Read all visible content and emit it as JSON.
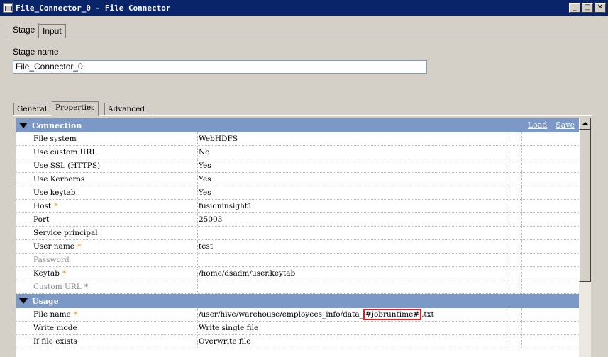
{
  "window": {
    "title": "File_Connector_0 - File Connector",
    "min_label": "_",
    "max_label": "□",
    "close_label": "✕"
  },
  "tabs": [
    {
      "label": "Stage",
      "active": true
    },
    {
      "label": "Input",
      "active": false
    }
  ],
  "stage_name": {
    "label": "Stage name",
    "value": "File_Connector_0"
  },
  "subtabs": [
    {
      "label": "General",
      "active": false
    },
    {
      "label": "Properties",
      "active": true
    },
    {
      "label": "Advanced",
      "active": false
    }
  ],
  "connection": {
    "title": "Connection",
    "load_label": "Load",
    "save_label": "Save",
    "rows": [
      {
        "name": "File system",
        "value": "WebHDFS",
        "required": false,
        "disabled": false
      },
      {
        "name": "Use custom URL",
        "value": "No",
        "required": false,
        "disabled": false
      },
      {
        "name": "Use SSL (HTTPS)",
        "value": "Yes",
        "required": false,
        "disabled": false
      },
      {
        "name": "Use Kerberos",
        "value": "Yes",
        "required": false,
        "disabled": false
      },
      {
        "name": "Use keytab",
        "value": "Yes",
        "required": false,
        "disabled": false
      },
      {
        "name": "Host",
        "value": "fusioninsight1",
        "required": true,
        "disabled": false
      },
      {
        "name": "Port",
        "value": "25003",
        "required": false,
        "disabled": false
      },
      {
        "name": "Service principal",
        "value": "",
        "required": false,
        "disabled": false
      },
      {
        "name": "User name",
        "value": "test",
        "required": true,
        "disabled": false
      },
      {
        "name": "Password",
        "value": "",
        "required": false,
        "disabled": true
      },
      {
        "name": "Keytab",
        "value": "/home/dsadm/user.keytab",
        "required": true,
        "disabled": false
      },
      {
        "name": "Custom URL",
        "value": "",
        "required": true,
        "disabled": true
      }
    ]
  },
  "usage": {
    "title": "Usage",
    "file_name": {
      "name": "File name",
      "value_prefix": "/user/hive/warehouse/employees_info/data_",
      "value_highlight": "#jobruntime#",
      "value_suffix": ".txt"
    },
    "rows": [
      {
        "name": "Write mode",
        "value": "Write single file"
      },
      {
        "name": "If file exists",
        "value": "Overwrite file"
      }
    ]
  },
  "required_marker": "*"
}
